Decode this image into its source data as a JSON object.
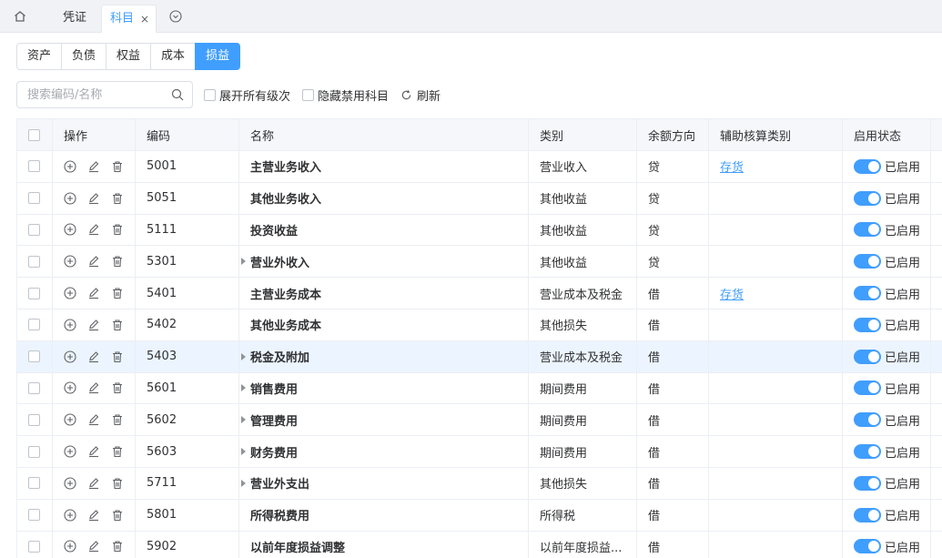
{
  "tabs": [
    {
      "label": "凭证"
    },
    {
      "label": "科目",
      "close": "×"
    }
  ],
  "categories": [
    "资产",
    "负债",
    "权益",
    "成本",
    "损益"
  ],
  "active_category": "损益",
  "search": {
    "placeholder": "搜索编码/名称",
    "value": ""
  },
  "options": {
    "expand_all": "展开所有级次",
    "hide_disabled": "隐藏禁用科目",
    "refresh": "刷新"
  },
  "columns": [
    "操作",
    "编码",
    "名称",
    "类别",
    "余额方向",
    "辅助核算类别",
    "启用状态"
  ],
  "rows": [
    {
      "code": "5001",
      "name": "主营业务收入",
      "type": "营业收入",
      "dir": "贷",
      "aux": "存货",
      "status": "已启用",
      "expandable": false
    },
    {
      "code": "5051",
      "name": "其他业务收入",
      "type": "其他收益",
      "dir": "贷",
      "aux": "",
      "status": "已启用",
      "expandable": false
    },
    {
      "code": "5111",
      "name": "投资收益",
      "type": "其他收益",
      "dir": "贷",
      "aux": "",
      "status": "已启用",
      "expandable": false
    },
    {
      "code": "5301",
      "name": "营业外收入",
      "type": "其他收益",
      "dir": "贷",
      "aux": "",
      "status": "已启用",
      "expandable": true
    },
    {
      "code": "5401",
      "name": "主营业务成本",
      "type": "营业成本及税金",
      "dir": "借",
      "aux": "存货",
      "status": "已启用",
      "expandable": false
    },
    {
      "code": "5402",
      "name": "其他业务成本",
      "type": "其他损失",
      "dir": "借",
      "aux": "",
      "status": "已启用",
      "expandable": false
    },
    {
      "code": "5403",
      "name": "税金及附加",
      "type": "营业成本及税金",
      "dir": "借",
      "aux": "",
      "status": "已启用",
      "expandable": true
    },
    {
      "code": "5601",
      "name": "销售费用",
      "type": "期间费用",
      "dir": "借",
      "aux": "",
      "status": "已启用",
      "expandable": true
    },
    {
      "code": "5602",
      "name": "管理费用",
      "type": "期间费用",
      "dir": "借",
      "aux": "",
      "status": "已启用",
      "expandable": true
    },
    {
      "code": "5603",
      "name": "财务费用",
      "type": "期间费用",
      "dir": "借",
      "aux": "",
      "status": "已启用",
      "expandable": true
    },
    {
      "code": "5711",
      "name": "营业外支出",
      "type": "其他损失",
      "dir": "借",
      "aux": "",
      "status": "已启用",
      "expandable": true
    },
    {
      "code": "5801",
      "name": "所得税费用",
      "type": "所得税",
      "dir": "借",
      "aux": "",
      "status": "已启用",
      "expandable": false
    },
    {
      "code": "5902",
      "name": "以前年度损益调整",
      "type": "以前年度损益...",
      "dir": "借",
      "aux": "",
      "status": "已启用",
      "expandable": false
    }
  ],
  "highlighted_row": 6,
  "colors": {
    "accent": "#409eff",
    "header_bg": "#f5f7fa",
    "highlight_bg": "#ecf5ff"
  }
}
